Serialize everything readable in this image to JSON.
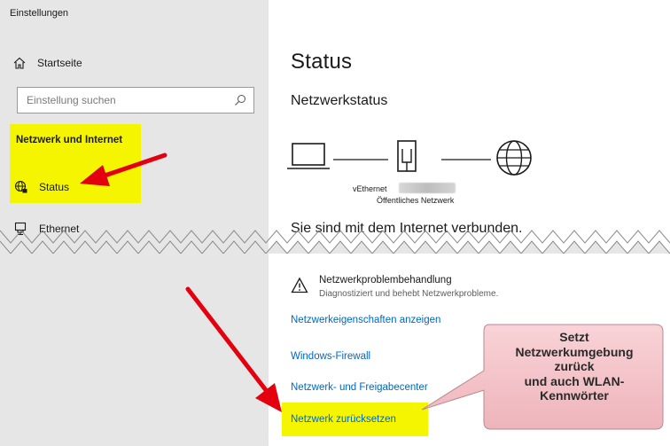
{
  "window": {
    "title": "Einstellungen"
  },
  "sidebar": {
    "home_label": "Startseite",
    "search_placeholder": "Einstellung suchen",
    "section_label": "Netzwerk und Internet",
    "items": [
      {
        "label": "Status",
        "icon": "globe-status-icon",
        "selected": true
      },
      {
        "label": "Ethernet",
        "icon": "ethernet-icon"
      }
    ]
  },
  "main": {
    "title": "Status",
    "subtitle": "Netzwerkstatus",
    "diagram": {
      "adapter_name": "vEthernet",
      "network_type": "Öffentliches Netzwerk"
    },
    "connection_status": "Sie sind mit dem Internet verbunden.",
    "troubleshooter": {
      "title": "Netzwerkproblembehandlung",
      "description": "Diagnostiziert und behebt Netzwerkprobleme."
    },
    "links": {
      "properties": "Netzwerkeigenschaften anzeigen",
      "firewall": "Windows-Firewall",
      "sharing_center": "Netzwerk- und Freigabecenter",
      "reset": "Netzwerk zurücksetzen"
    }
  },
  "annotation": {
    "callout_text": "Setzt\nNetzwerkumgebung\nzurück\nund auch WLAN-\nKennwörter",
    "highlight_color": "#f5f500",
    "arrow_color": "#e3000f",
    "callout_color": "#f4c7cc"
  },
  "colors": {
    "sidebar_bg": "#e6e6e6",
    "link": "#0067c0"
  }
}
